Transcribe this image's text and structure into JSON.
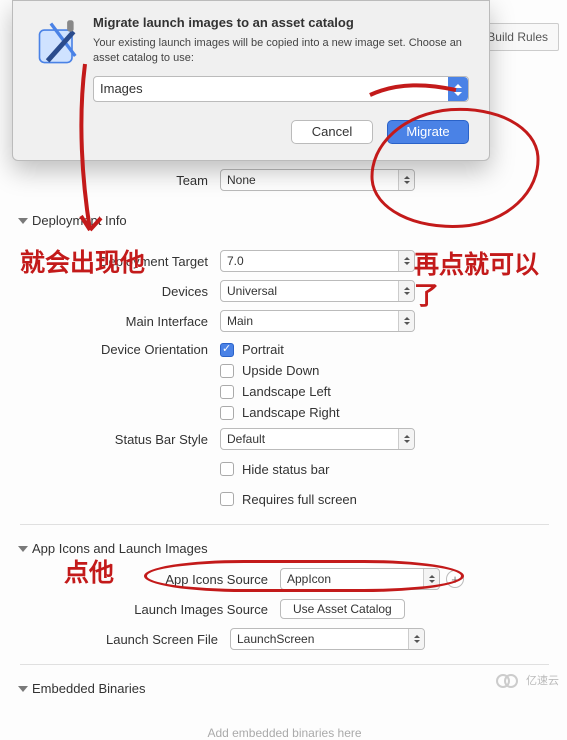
{
  "topTab": {
    "label": "Build Rules"
  },
  "dialog": {
    "title": "Migrate launch images to an asset catalog",
    "message": "Your existing launch images will be copied into a new image set. Choose an asset catalog to use:",
    "catalogSelected": "Images",
    "cancel": "Cancel",
    "migrate": "Migrate"
  },
  "team": {
    "label": "Team",
    "value": "None"
  },
  "sections": {
    "deploymentInfo": "Deployment Info",
    "appIcons": "App Icons and Launch Images",
    "embeddedBinaries": "Embedded Binaries"
  },
  "deploy": {
    "targetLabel": "Deployment Target",
    "targetValue": "7.0",
    "devicesLabel": "Devices",
    "devicesValue": "Universal",
    "mainInterfaceLabel": "Main Interface",
    "mainInterfaceValue": "Main",
    "orientationLabel": "Device Orientation",
    "orientations": {
      "portrait": "Portrait",
      "upsideDown": "Upside Down",
      "landscapeLeft": "Landscape Left",
      "landscapeRight": "Landscape Right"
    },
    "statusBarLabel": "Status Bar Style",
    "statusBarValue": "Default",
    "hideStatusBar": "Hide status bar",
    "requiresFullScreen": "Requires full screen"
  },
  "icons": {
    "appIconsLabel": "App Icons Source",
    "appIconsValue": "AppIcon",
    "launchImagesLabel": "Launch Images Source",
    "launchImagesButton": "Use Asset Catalog",
    "launchScreenLabel": "Launch Screen File",
    "launchScreenValue": "LaunchScreen"
  },
  "embedded": {
    "hint": "Add embedded binaries here"
  },
  "annotations": {
    "a1": "就会出现他",
    "a2": "再点就可以了",
    "a3": "点他"
  },
  "watermark": "亿速云"
}
